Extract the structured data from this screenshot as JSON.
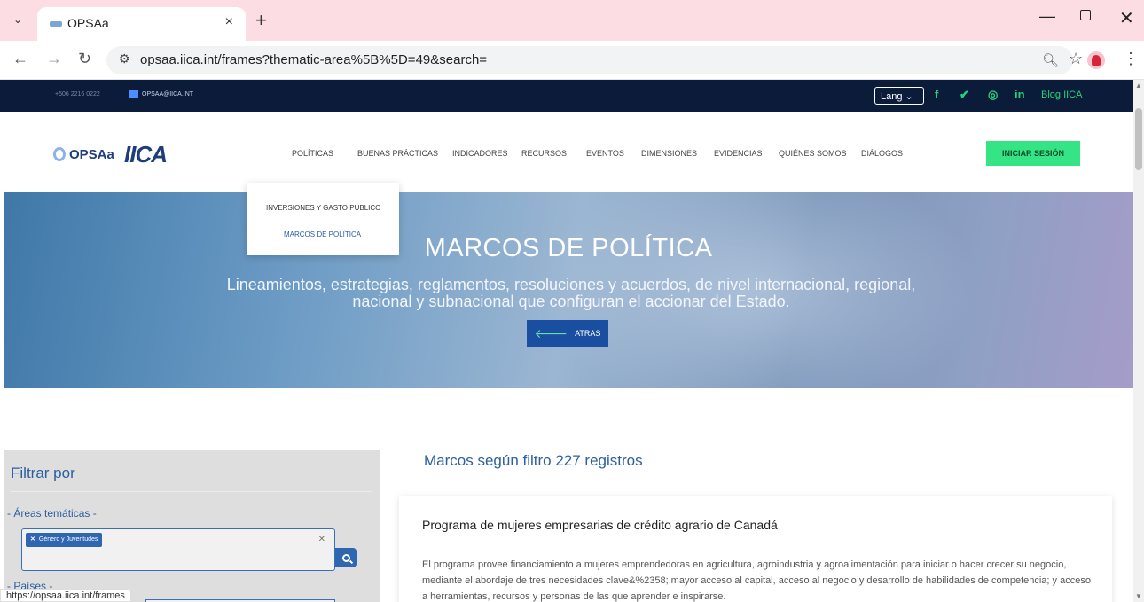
{
  "browser": {
    "tab_title": "OPSAa",
    "tab_close": "×",
    "new_tab": "+",
    "url": "opsaa.iica.int/frames?thematic-area%5B%5D=49&search=",
    "status_url": "https://opsaa.iica.int/frames",
    "icons": [
      "tab-dropdown-icon",
      "back-icon",
      "forward-icon",
      "reload-icon",
      "site-info-icon",
      "zoom-icon",
      "star-icon",
      "profile-icon",
      "kebab-icon"
    ]
  },
  "topbar": {
    "phone": "+506 2216 0222",
    "email": "OPSAA@IICA.INT",
    "lang": "Lang",
    "social_icons": [
      "facebook-icon",
      "twitter-icon",
      "instagram-icon",
      "linkedin-icon"
    ],
    "blog": "Blog IICA",
    "accent": "#23d37a"
  },
  "nav": {
    "logo_opsaa": "OPSAa",
    "logo_iica": "IICA",
    "items": [
      "POLÍTICAS",
      "BUENAS PRÁCTICAS",
      "INDICADORES",
      "RECURSOS",
      "EVENTOS",
      "DIMENSIONES",
      "EVIDENCIAS",
      "QUIÉNES SOMOS",
      "DIÁLOGOS"
    ],
    "login": "INICIAR SESIÓN"
  },
  "dropdown": {
    "item1": "INVERSIONES Y GASTO PÚBLICO",
    "item2": "MARCOS DE POLÍTICA"
  },
  "hero": {
    "title": "MARCOS DE POLÍTICA",
    "subtitle": "Lineamientos, estrategias, reglamentos, resoluciones y acuerdos, de nivel internacional, regional, nacional y subnacional que configuran el accionar del Estado.",
    "back": "ATRAS"
  },
  "filter": {
    "title": "Filtrar por",
    "label_areas": "- Áreas temáticas -",
    "chip": "Género y Juventudes",
    "label_paises": "- Países -"
  },
  "results": {
    "title": "Marcos según filtro 227 registros",
    "card_title": "Programa de mujeres empresarias de crédito agrario de Canadá",
    "card_body": "El programa provee financiamiento a mujeres emprendedoras en agricultura, agroindustria y agroalimentación para iniciar o hacer crecer su negocio, mediante el abordaje de tres necesidades clave&%2358; mayor acceso al capital, acceso al negocio y desarrollo de habilidades de competencia; y acceso a herramientas, recursos y personas de las que aprender e inspirarse."
  }
}
